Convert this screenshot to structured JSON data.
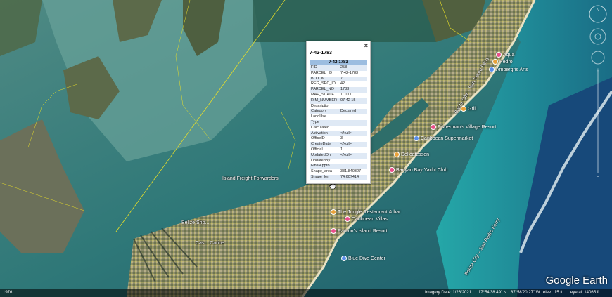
{
  "map": {
    "place_labels": [
      "Island Freight Forwarders",
      "Belize Sho...",
      "Cas... Caribe",
      "Belize City – San Pedro Ferry",
      "Belize City – San Pedro Ferry"
    ],
    "pois": [
      {
        "name": "The Jungle Restaurant & bar",
        "color": "#e8a23a"
      },
      {
        "name": "Caribbean Villas",
        "color": "#e84f8a"
      },
      {
        "name": "Ramon's Island Resort",
        "color": "#e84f8a"
      },
      {
        "name": "Banyan Bay Yacht Club",
        "color": "#e84f8a"
      },
      {
        "name": "Fisherman's Village Resort",
        "color": "#e84f8a"
      },
      {
        "name": "Caribbean Supermarket",
        "color": "#5a8ee8"
      },
      {
        "name": "Delicatessen",
        "color": "#e8a23a"
      },
      {
        "name": "Grill",
        "color": "#e8a23a"
      },
      {
        "name": "Blue Dive Center",
        "color": "#5a8ee8"
      },
      {
        "name": "Pedro",
        "color": "#e8a23a"
      },
      {
        "name": "Ambergris Arts",
        "color": "#5a8ee8"
      },
      {
        "name": "Aqua",
        "color": "#e84f8a"
      }
    ]
  },
  "popup": {
    "title": "7-42-1783",
    "close_label": "×",
    "header": "7-42-1783",
    "rows": [
      {
        "key": "FID",
        "value": "258"
      },
      {
        "key": "PARCEL_ID",
        "value": "7-42-1783"
      },
      {
        "key": "BLOCK",
        "value": "7"
      },
      {
        "key": "REG_SEC_ID",
        "value": "42"
      },
      {
        "key": "PARCEL_NO",
        "value": "1783"
      },
      {
        "key": "MAP_SCALE",
        "value": "1:1000"
      },
      {
        "key": "RIM_NUMBER",
        "value": "07 42 15"
      },
      {
        "key": "Descriptio",
        "value": ""
      },
      {
        "key": "Category",
        "value": "Declared"
      },
      {
        "key": "LandUse",
        "value": ""
      },
      {
        "key": "Type",
        "value": ""
      },
      {
        "key": "Calculated",
        "value": ""
      },
      {
        "key": "Activation",
        "value": "<Null>"
      },
      {
        "key": "OfficeID",
        "value": "3"
      },
      {
        "key": "CreateDate",
        "value": "<Null>"
      },
      {
        "key": "Official",
        "value": "1"
      },
      {
        "key": "UpdatedOn",
        "value": "<Null>"
      },
      {
        "key": "UpdatedBy",
        "value": ""
      },
      {
        "key": "FinalAppro",
        "value": ""
      },
      {
        "key": "Shape_area",
        "value": "331.840327"
      },
      {
        "key": "Shape_len",
        "value": "74.607414"
      }
    ]
  },
  "status": {
    "left": "1976",
    "imagery_date": "Imagery Date: 1/26/2021",
    "lat": "17°54'38.49\" N",
    "lon": "87°58'20.27\" W",
    "elev": "elev",
    "elev_value": "15 ft",
    "eye_alt": "eye alt  14065 ft"
  },
  "brand": "Google Earth"
}
